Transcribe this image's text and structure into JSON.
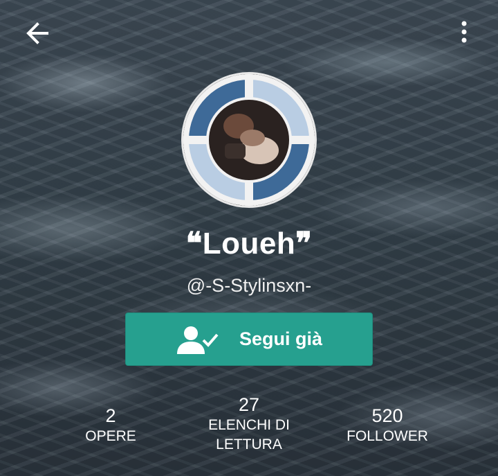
{
  "header": {
    "back_icon": "arrow-left-icon",
    "menu_icon": "more-vertical-icon"
  },
  "profile": {
    "display_name": "❝Loueh❞",
    "username": "@-S-Stylinsxn-"
  },
  "follow_button": {
    "label": "Segui già",
    "icon": "user-check-icon",
    "color": "#26a08f"
  },
  "stats": [
    {
      "value": "2",
      "label": "OPERE"
    },
    {
      "value": "27",
      "label": "ELENCHI DI LETTURA"
    },
    {
      "value": "520",
      "label": "FOLLOWER"
    }
  ]
}
